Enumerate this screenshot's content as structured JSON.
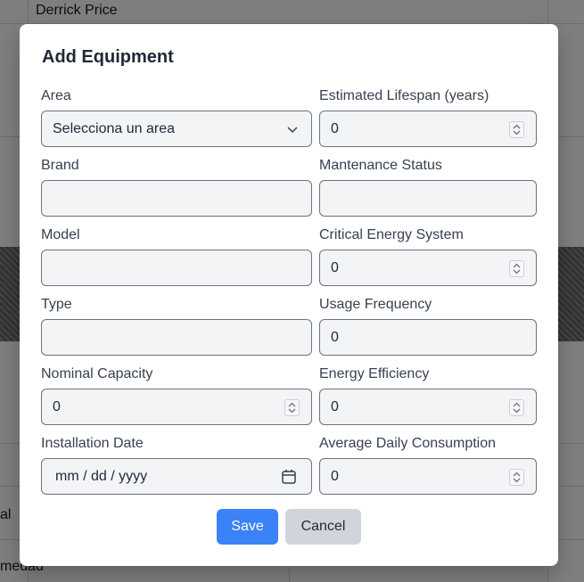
{
  "background": {
    "rows": [
      "Derrick Price",
      "al",
      "medad"
    ]
  },
  "modal": {
    "title": "Add Equipment",
    "fields": {
      "area": {
        "label": "Area",
        "value": "Selecciona un area"
      },
      "brand": {
        "label": "Brand",
        "value": ""
      },
      "model": {
        "label": "Model",
        "value": ""
      },
      "type": {
        "label": "Type",
        "value": ""
      },
      "nominal_capacity": {
        "label": "Nominal Capacity",
        "value": "0"
      },
      "installation_date": {
        "label": "Installation Date",
        "value": "mm / dd / yyyy"
      },
      "estimated_lifespan": {
        "label": "Estimated Lifespan (years)",
        "value": "0"
      },
      "maintenance_status": {
        "label": "Mantenance Status",
        "value": ""
      },
      "critical_energy_system": {
        "label": "Critical Energy System",
        "value": "0"
      },
      "usage_frequency": {
        "label": "Usage Frequency",
        "value": "0"
      },
      "energy_efficiency": {
        "label": "Energy Efficiency",
        "value": "0"
      },
      "average_daily_consumption": {
        "label": "Average Daily Consumption",
        "value": "0"
      }
    },
    "buttons": {
      "save": "Save",
      "cancel": "Cancel"
    },
    "colors": {
      "primary": "#3b82f6",
      "secondary": "#d1d5db",
      "input_bg": "#f3f4f6"
    }
  }
}
